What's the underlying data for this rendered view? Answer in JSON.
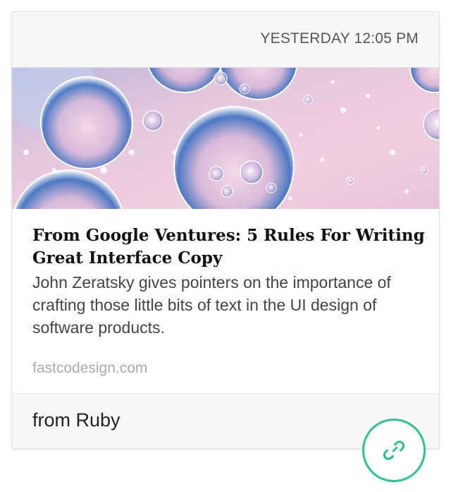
{
  "card": {
    "timestamp": "YESTERDAY 12:05 PM",
    "article": {
      "title": "From Google Ventures: 5 Rules For Writing Great Interface Copy",
      "summary": "John Zeratsky gives pointers on the importance of crafting those little bits of text in the UI design of software products.",
      "domain": "fastcodesign.com"
    },
    "footer": {
      "from_label": "from Ruby"
    }
  },
  "actions": {
    "link_icon": "link-icon"
  },
  "colors": {
    "accent": "#2bc48a",
    "header_bg": "#f7f7f7",
    "title": "#111111",
    "summary": "#444444",
    "domain": "#aaaaaa"
  }
}
